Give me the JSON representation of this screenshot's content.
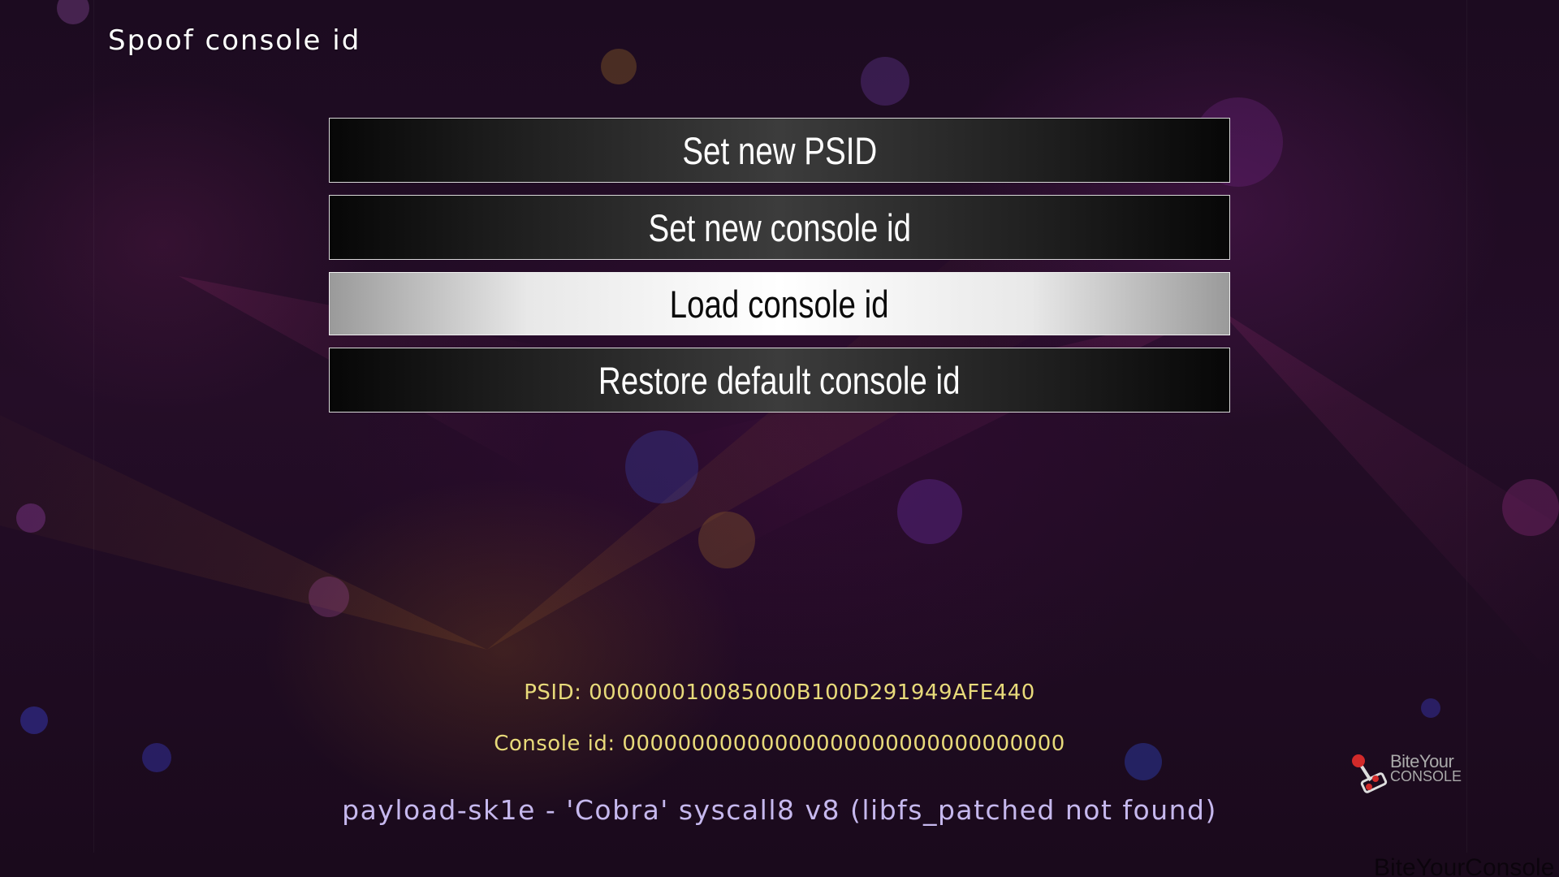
{
  "header": {
    "title": "Spoof console id"
  },
  "menu": {
    "items": [
      {
        "label": "Set new PSID"
      },
      {
        "label": "Set new console id"
      },
      {
        "label": "Load console id"
      },
      {
        "label": "Restore default console id"
      }
    ],
    "selected_label": "Load console id"
  },
  "info": {
    "psid": "PSID: 000000010085000B100D291949AFE440",
    "console_id": "Console id: 00000000000000000000000000000000"
  },
  "footer": {
    "payload_status": "payload-sk1e - 'Cobra' syscall8 v8 (libfs_patched not found)"
  },
  "branding": {
    "logo_line1": "BiteYour",
    "logo_line2": "CONSOLE",
    "watermark": "BiteYourConsole"
  },
  "colors": {
    "info_text": "#e8da7a",
    "payload_text": "#c6b8ee",
    "selected_bg": "#ffffff",
    "unselected_bg": "#1e1e1e"
  }
}
